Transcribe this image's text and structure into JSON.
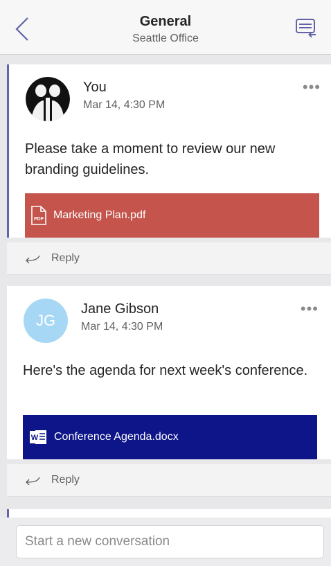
{
  "header": {
    "title": "General",
    "subtitle": "Seattle Office"
  },
  "posts": [
    {
      "author": "You",
      "timestamp": "Mar 14, 4:30 PM",
      "message": "Please take a moment to review our new branding guidelines.",
      "attachment": {
        "name": "Marketing Plan.pdf",
        "type": "pdf",
        "color": "#c4544c",
        "icon": "pdf-file-icon"
      },
      "reply_label": "Reply",
      "more_label": "•••"
    },
    {
      "author": "Jane Gibson",
      "initials": "JG",
      "timestamp": "Mar 14, 4:30 PM",
      "message": "Here's the agenda for next week's conference.",
      "attachment": {
        "name": "Conference Agenda.docx",
        "type": "word",
        "color": "#0d1589",
        "icon": "word-file-icon"
      },
      "reply_label": "Reply",
      "more_label": "•••"
    }
  ],
  "composer": {
    "placeholder": "Start a new conversation"
  },
  "colors": {
    "accent": "#6264a7",
    "avatar_jg": "#a6d8f5"
  }
}
